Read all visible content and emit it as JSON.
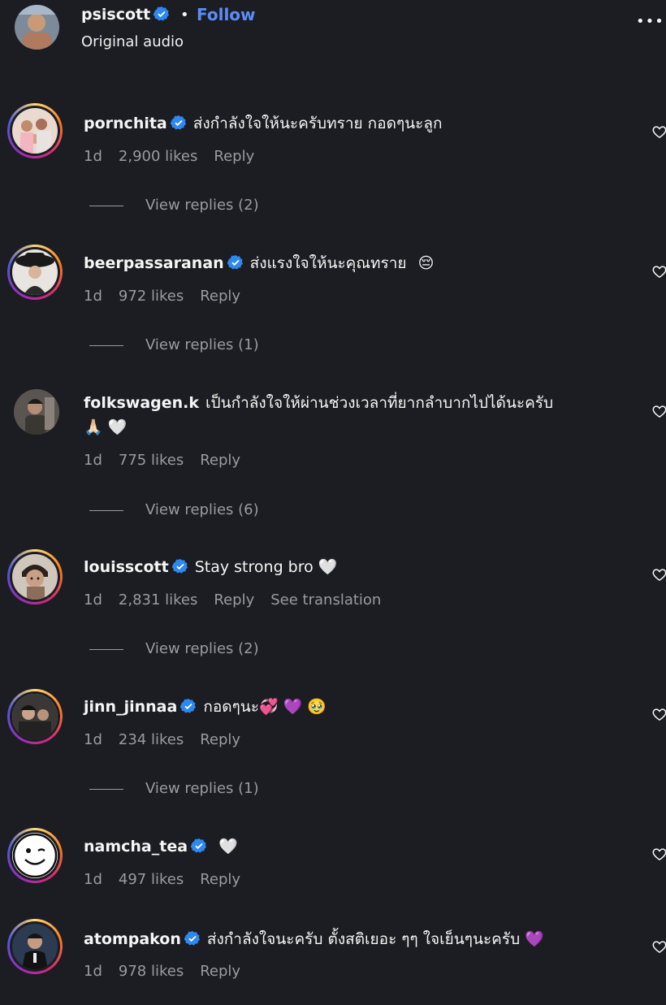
{
  "post": {
    "username": "psiscott",
    "separator": "•",
    "follow_label": "Follow",
    "audio": "Original audio",
    "more_icon": "more-horizontal-icon",
    "more_glyph": "•••"
  },
  "comments": [
    {
      "username": "pornchita",
      "verified": true,
      "text": "ส่งกำลังใจให้นะครับทราย กอดๆนะลูก",
      "time": "1d",
      "likes": "2,900 likes",
      "reply": "Reply",
      "view_replies": "View replies (2)"
    },
    {
      "username": "beerpassaranan",
      "verified": true,
      "text": "ส่งแรงใจให้นะคุณทราย",
      "emoji_after": "😔",
      "time": "1d",
      "likes": "972 likes",
      "reply": "Reply",
      "view_replies": "View replies (1)"
    },
    {
      "username": "folkswagen.k",
      "verified": false,
      "text": "เป็นกำลังใจให้ผ่านช่วงเวลาที่ยากลำบากไปได้นะครับ",
      "text2": "🙏🏻 🤍",
      "time": "1d",
      "likes": "775 likes",
      "reply": "Reply",
      "view_replies": "View replies (6)"
    },
    {
      "username": "louisscott",
      "verified": true,
      "text": "Stay strong bro 🤍",
      "time": "1d",
      "likes": "2,831 likes",
      "reply": "Reply",
      "see_translation": "See translation",
      "view_replies": "View replies (2)"
    },
    {
      "username": "jinn_jinnaa",
      "verified": true,
      "text": "กอดๆนะ💞 💜 🥹",
      "time": "1d",
      "likes": "234 likes",
      "reply": "Reply",
      "view_replies": "View replies (1)"
    },
    {
      "username": "namcha_tea",
      "verified": true,
      "text": "🤍",
      "time": "1d",
      "likes": "497 likes",
      "reply": "Reply"
    },
    {
      "username": "atompakon",
      "verified": true,
      "text": "ส่งกำลังใจนะครับ ตั้งสติเยอะ ๆๆ ใจเย็นๆนะครับ 💜",
      "time": "1d",
      "likes": "978 likes",
      "reply": "Reply"
    }
  ],
  "colors": {
    "background": "#1c1d22",
    "verified_blue": "#2d88f0",
    "follow_blue": "#5b8cf7",
    "meta_gray": "#9a9ba0"
  }
}
